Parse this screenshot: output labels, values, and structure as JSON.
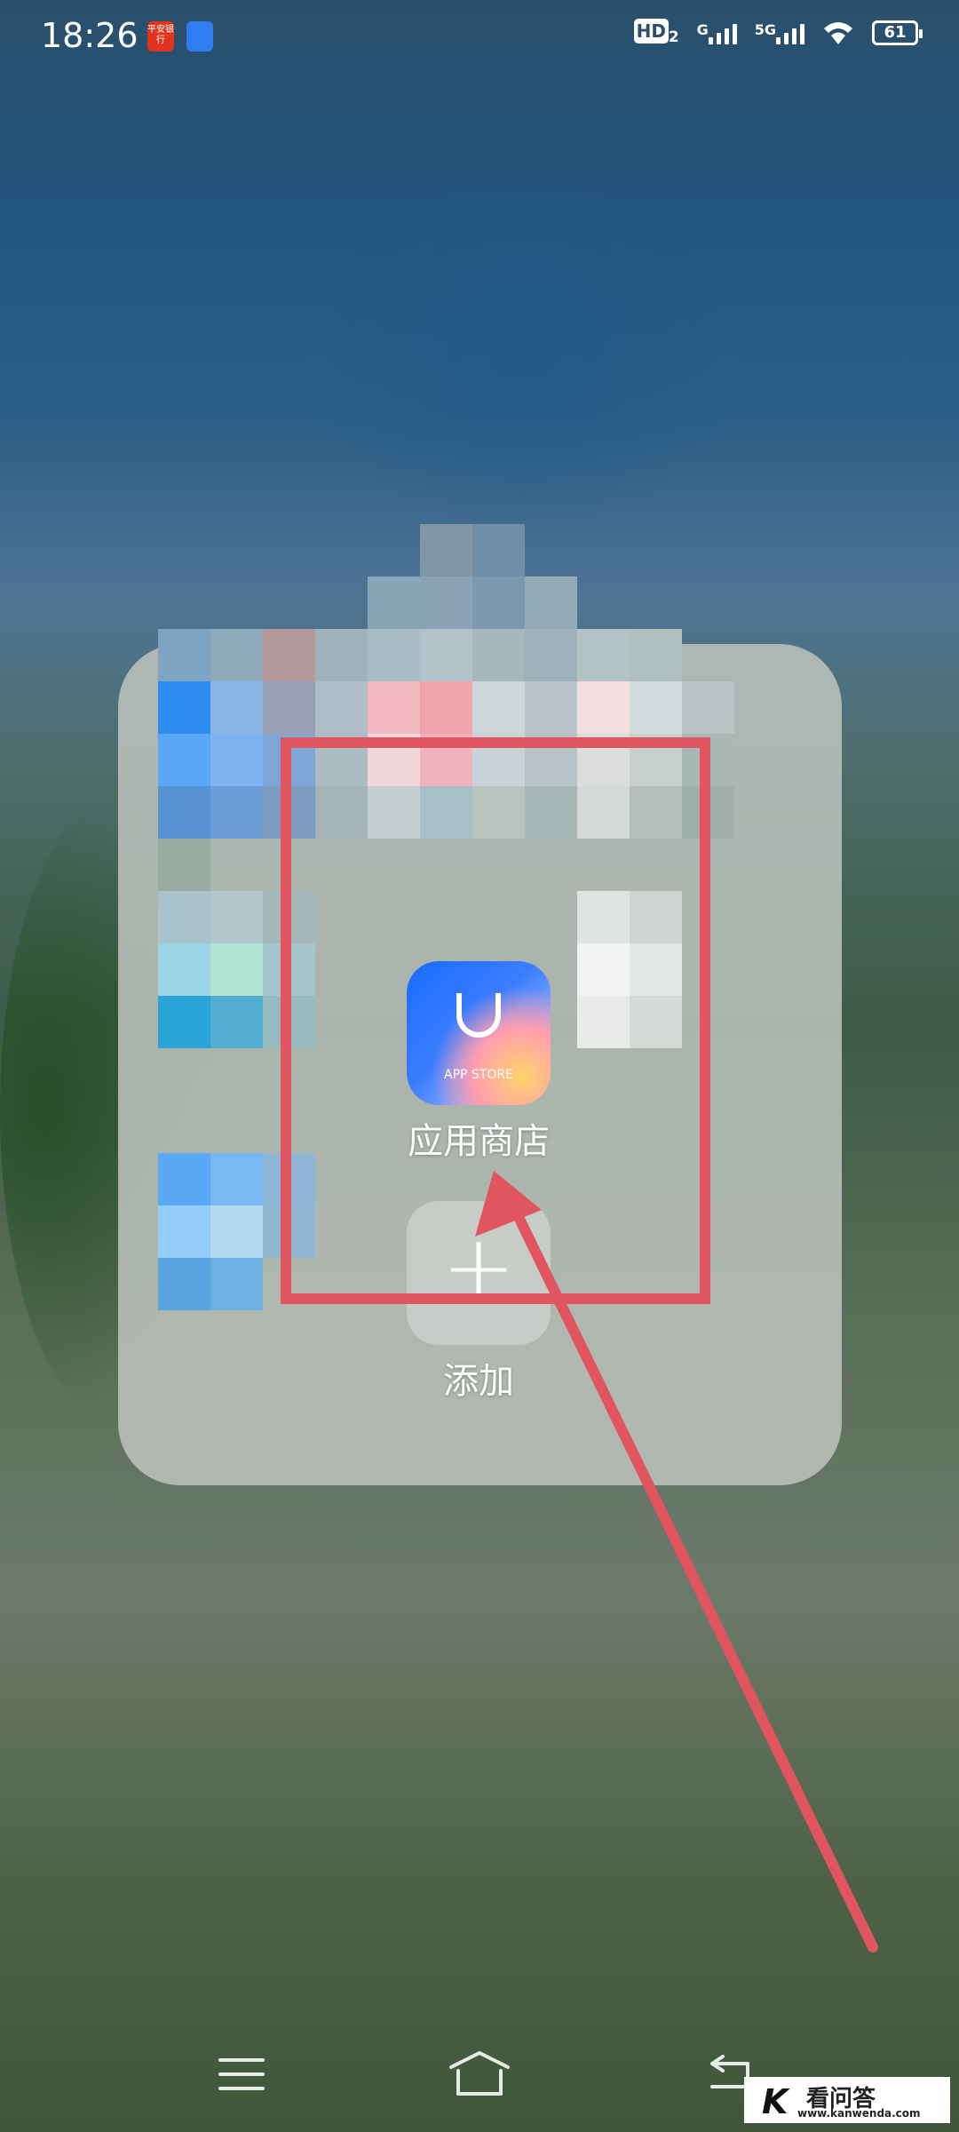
{
  "status_bar": {
    "time": "18:26",
    "notifications": [
      {
        "name": "ping-an-bank",
        "text": "平安银行",
        "color": "#e0341d"
      },
      {
        "name": "blue-app",
        "color": "#2f7df0"
      }
    ],
    "hd_label": "HD",
    "hd_sim": "2",
    "sim1_network": "G",
    "sim2_network": "5G",
    "battery": "61"
  },
  "folder": {
    "apps": [
      {
        "label": "应用商店",
        "icon_text": "APP STORE"
      }
    ],
    "add_label": "添加",
    "add_icon": "plus-icon"
  },
  "annotation": {
    "highlight_color": "#e05560"
  },
  "nav_bar": {
    "menu": "menu-icon",
    "home": "home-icon",
    "back": "back-icon"
  },
  "watermark": {
    "brand": "看问答",
    "url": "www.kanwenda.com"
  }
}
